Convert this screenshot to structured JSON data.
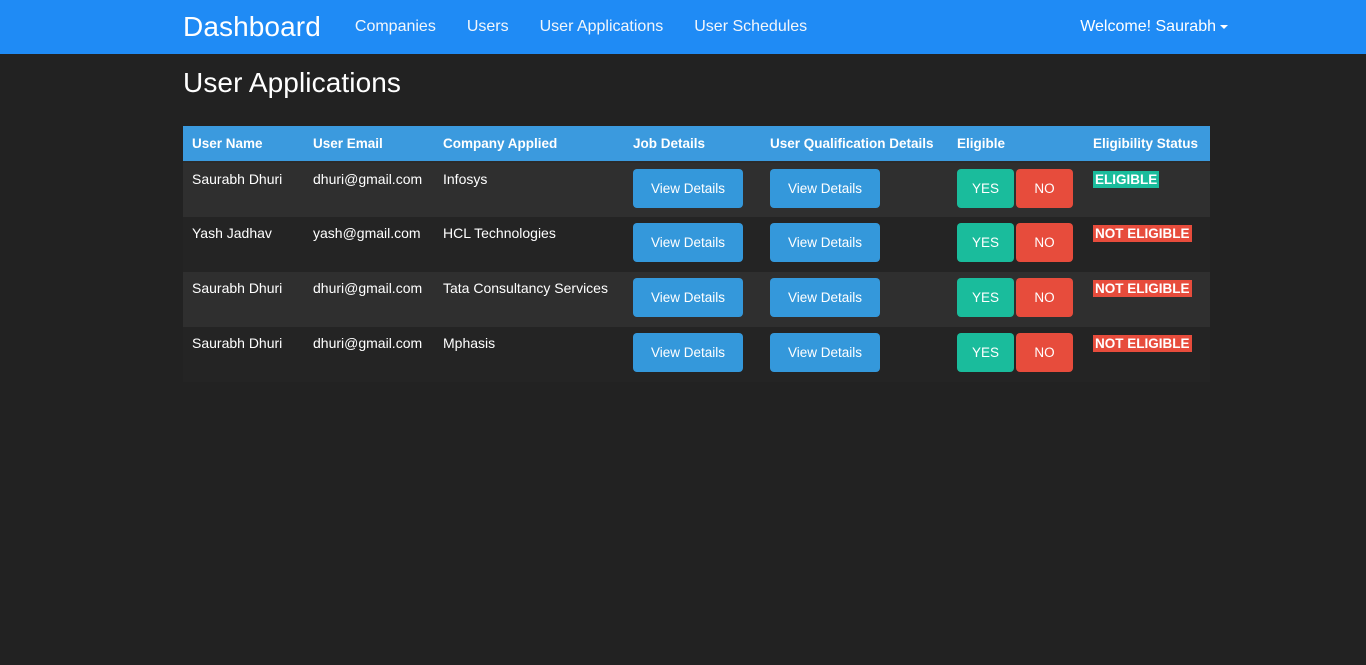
{
  "navbar": {
    "brand": "Dashboard",
    "links": [
      {
        "label": "Companies"
      },
      {
        "label": "Users"
      },
      {
        "label": "User Applications"
      },
      {
        "label": "User Schedules"
      }
    ],
    "user_menu": {
      "label": "Welcome! Saurabh",
      "caret_icon": "chevron-down-icon"
    },
    "background_color": "#1f8bf5"
  },
  "page": {
    "title": "User Applications",
    "background_color": "#222222"
  },
  "table": {
    "header_color": "#3b9ade",
    "columns": [
      "User Name",
      "User Email",
      "Company Applied",
      "Job Details",
      "User Qualification Details",
      "Eligible",
      "Eligibility Status"
    ],
    "buttons": {
      "view_details": "View Details",
      "yes": "YES",
      "no": "NO",
      "view_details_color": "#3498db",
      "yes_color": "#1abc9c",
      "no_color": "#e74c3c"
    },
    "rows": [
      {
        "user_name": "Saurabh Dhuri",
        "user_email": "dhuri@gmail.com",
        "company_applied": "Infosys",
        "job_details": "View Details",
        "qualification_details": "View Details",
        "eligible_yes": "YES",
        "eligible_no": "NO",
        "status": "ELIGIBLE",
        "status_color": "#1abc9c"
      },
      {
        "user_name": "Yash Jadhav",
        "user_email": "yash@gmail.com",
        "company_applied": "HCL Technologies",
        "job_details": "View Details",
        "qualification_details": "View Details",
        "eligible_yes": "YES",
        "eligible_no": "NO",
        "status": "NOT ELIGIBLE",
        "status_color": "#e74c3c"
      },
      {
        "user_name": "Saurabh Dhuri",
        "user_email": "dhuri@gmail.com",
        "company_applied": "Tata Consultancy Services",
        "job_details": "View Details",
        "qualification_details": "View Details",
        "eligible_yes": "YES",
        "eligible_no": "NO",
        "status": "NOT ELIGIBLE",
        "status_color": "#e74c3c"
      },
      {
        "user_name": "Saurabh Dhuri",
        "user_email": "dhuri@gmail.com",
        "company_applied": "Mphasis",
        "job_details": "View Details",
        "qualification_details": "View Details",
        "eligible_yes": "YES",
        "eligible_no": "NO",
        "status": "NOT ELIGIBLE",
        "status_color": "#e74c3c"
      }
    ]
  }
}
